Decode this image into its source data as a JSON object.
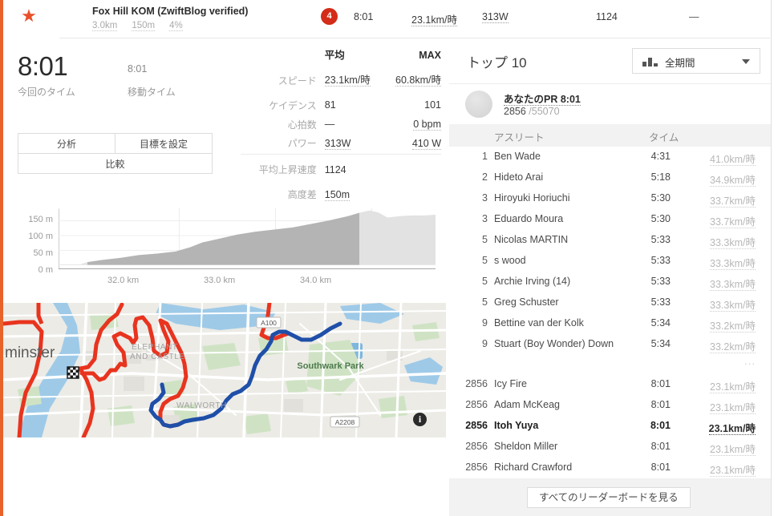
{
  "header": {
    "star_icon": "star-icon",
    "title": "Fox Hill KOM (ZwiftBlog verified)",
    "distance": "3.0km",
    "elevation": "150m",
    "grade": "4%",
    "badge": "4",
    "time": "8:01",
    "speed": "23.1km/時",
    "power": "313W",
    "vam": "1124",
    "heartrate": "—"
  },
  "effort": {
    "time_value": "8:01",
    "time_label": "今回のタイム",
    "moving_value": "8:01",
    "moving_label": "移動タイム",
    "btn_analysis": "分析",
    "btn_goal": "目標を設定",
    "btn_compare": "比較"
  },
  "stats": {
    "col_avg": "平均",
    "col_max": "MAX",
    "rows": [
      {
        "label": "スピード",
        "avg": "23.1km/時",
        "max": "60.8km/時"
      },
      {
        "label": "ケイデンス",
        "avg": "81",
        "max": "101"
      },
      {
        "label": "心拍数",
        "avg": "—",
        "max": "0 bpm"
      },
      {
        "label": "パワー",
        "avg": "313W",
        "max": "410 W"
      }
    ],
    "extra": [
      {
        "label": "平均上昇速度",
        "value": "1124"
      },
      {
        "label": "高度差",
        "value": "150m"
      }
    ]
  },
  "chart_data": {
    "type": "area",
    "title": "",
    "xlabel": "",
    "ylabel": "",
    "y_ticks": [
      "150 m",
      "100 m",
      "50 m",
      "0 m"
    ],
    "ylim": [
      0,
      175
    ],
    "x_ticks": [
      "32.0 km",
      "33.0 km",
      "34.0 km"
    ],
    "xlim": [
      31.55,
      34.62
    ],
    "grid": true,
    "legend": "none",
    "x": [
      31.55,
      31.72,
      31.78,
      31.9,
      32.05,
      32.2,
      32.35,
      32.5,
      32.62,
      32.72,
      32.85,
      33.0,
      33.15,
      33.3,
      33.45,
      33.6,
      33.75,
      33.9,
      34.0,
      34.08,
      34.15,
      34.22,
      34.32,
      34.42,
      34.52,
      34.62
    ],
    "values": [
      3,
      3,
      8,
      14,
      20,
      26,
      30,
      36,
      50,
      62,
      74,
      86,
      93,
      100,
      106,
      116,
      126,
      137,
      148,
      155,
      148,
      136,
      140,
      141,
      142,
      143
    ],
    "highlight_range": [
      31.78,
      34.15
    ],
    "unit": "m"
  },
  "map": {
    "labels": [
      {
        "text": "minster",
        "size": 18,
        "color": "#595959"
      },
      {
        "text": "ELEPHANT",
        "size": 10,
        "color": "#9b9b9b"
      },
      {
        "text": "AND CASTLE",
        "size": 10,
        "color": "#9b9b9b"
      },
      {
        "text": "WALWORTH",
        "size": 10,
        "color": "#9b9b9b"
      },
      {
        "text": "Southwark Park",
        "size": 11,
        "color": "#4e7a4e"
      },
      {
        "text": "A100",
        "size": 8,
        "color": "#555"
      },
      {
        "text": "A2208",
        "size": 8,
        "color": "#555"
      }
    ],
    "route_color": "#e8341f",
    "segment_color": "#1f4fa8",
    "info_icon": "info-icon",
    "start_icon": "checkered-flag-icon"
  },
  "leaderboard": {
    "title": "トップ 10",
    "filter_icon": "bar-chart-icon",
    "filter_value": "全期間",
    "pr_avatar": "avatar",
    "pr_title": "あなたのPR 8:01",
    "pr_rank": "2856",
    "pr_total": "/55070",
    "col_athlete": "アスリート",
    "col_time": "タイム",
    "ellipsis": "...",
    "view_all": "すべてのリーダーボードを見る",
    "rows": [
      {
        "rank": "1",
        "name": "Ben Wade",
        "time": "4:31",
        "speed": "41.0km/時",
        "me": false
      },
      {
        "rank": "2",
        "name": "Hideto Arai",
        "time": "5:18",
        "speed": "34.9km/時",
        "me": false
      },
      {
        "rank": "3",
        "name": "Hiroyuki Horiuchi",
        "time": "5:30",
        "speed": "33.7km/時",
        "me": false
      },
      {
        "rank": "3",
        "name": "Eduardo Moura",
        "time": "5:30",
        "speed": "33.7km/時",
        "me": false
      },
      {
        "rank": "5",
        "name": "Nicolas MARTIN",
        "time": "5:33",
        "speed": "33.3km/時",
        "me": false
      },
      {
        "rank": "5",
        "name": "s wood",
        "time": "5:33",
        "speed": "33.3km/時",
        "me": false
      },
      {
        "rank": "5",
        "name": "Archie Irving (14)",
        "time": "5:33",
        "speed": "33.3km/時",
        "me": false
      },
      {
        "rank": "5",
        "name": "Greg Schuster",
        "time": "5:33",
        "speed": "33.3km/時",
        "me": false
      },
      {
        "rank": "9",
        "name": "Bettine van der Kolk",
        "time": "5:34",
        "speed": "33.2km/時",
        "me": false
      },
      {
        "rank": "9",
        "name": "Stuart (Boy Wonder) Down",
        "time": "5:34",
        "speed": "33.2km/時",
        "me": false
      }
    ],
    "rows_bottom": [
      {
        "rank": "2856",
        "name": "Icy Fire",
        "time": "8:01",
        "speed": "23.1km/時",
        "me": false
      },
      {
        "rank": "2856",
        "name": "Adam McKeag",
        "time": "8:01",
        "speed": "23.1km/時",
        "me": false
      },
      {
        "rank": "2856",
        "name": "Itoh Yuya",
        "time": "8:01",
        "speed": "23.1km/時",
        "me": true
      },
      {
        "rank": "2856",
        "name": "Sheldon Miller",
        "time": "8:01",
        "speed": "23.1km/時",
        "me": false
      },
      {
        "rank": "2856",
        "name": "Richard Crawford",
        "time": "8:01",
        "speed": "23.1km/時",
        "me": false
      }
    ]
  }
}
